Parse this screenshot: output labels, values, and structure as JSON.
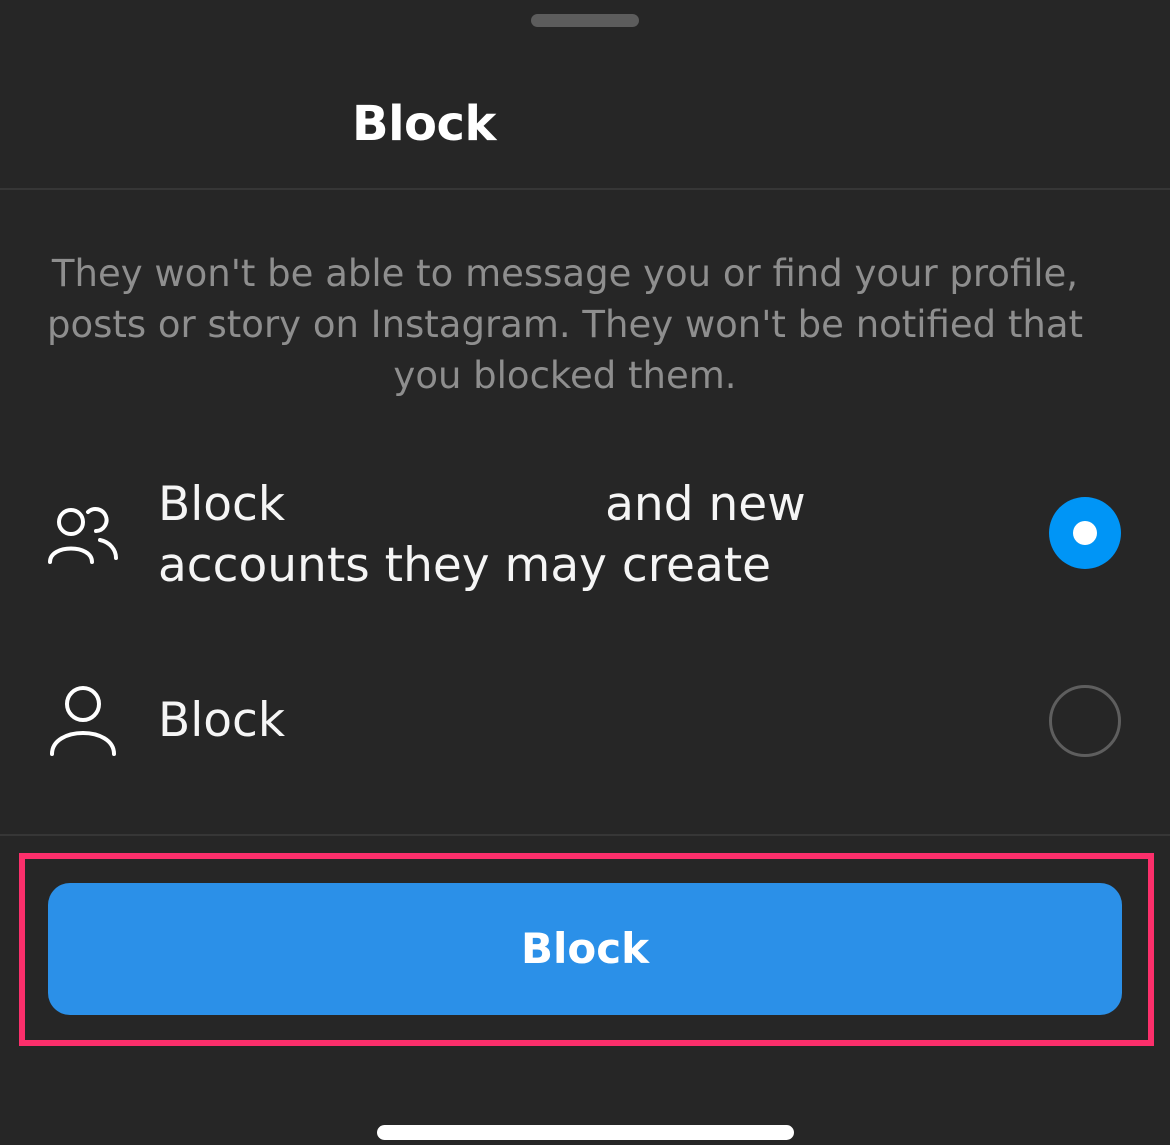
{
  "sheet": {
    "title": "Block",
    "description": "They won't be able to message you or find your profile, posts or story on Instagram. They won't be notified that you blocked them."
  },
  "options": [
    {
      "label_part1": "Block",
      "label_part2": "and new",
      "label_line2": "accounts they may create",
      "icon": "people-icon",
      "selected": true
    },
    {
      "label": "Block",
      "icon": "person-icon",
      "selected": false
    }
  ],
  "action": {
    "button_label": "Block"
  },
  "colors": {
    "background": "#262626",
    "accent": "#0095f6",
    "button": "#2b90e8",
    "highlight": "#fb2f6b",
    "secondary_text": "#8e8e8e"
  }
}
